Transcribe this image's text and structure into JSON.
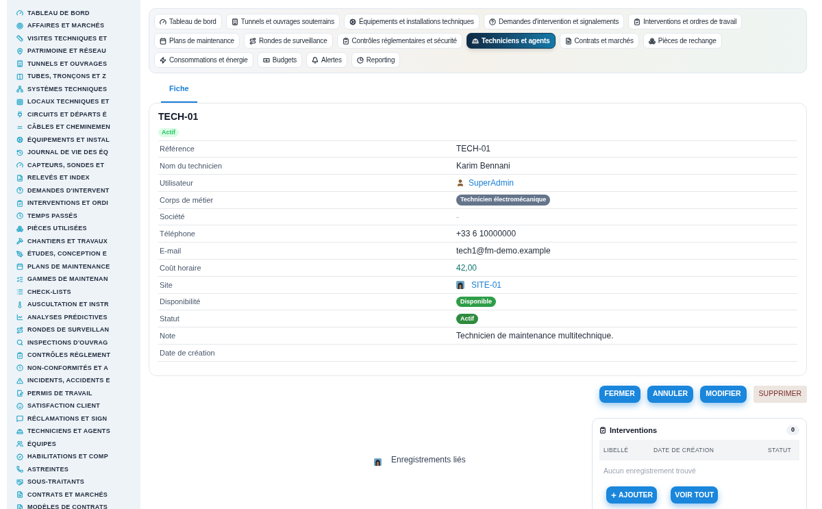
{
  "sidebar": {
    "items": [
      {
        "label": "TABLEAU DE BORD"
      },
      {
        "label": "AFFAIRES ET MARCHÉS"
      },
      {
        "label": "VISITES TECHNIQUES ET"
      },
      {
        "label": "PATRIMOINE ET RÉSEAU"
      },
      {
        "label": "TUNNELS ET OUVRAGES"
      },
      {
        "label": "TUBES, TRONÇONS ET Z"
      },
      {
        "label": "SYSTÈMES TECHNIQUES"
      },
      {
        "label": "LOCAUX TECHNIQUES ET"
      },
      {
        "label": "CIRCUITS ET DÉPARTS É"
      },
      {
        "label": "CÂBLES ET CHEMINEMEN"
      },
      {
        "label": "ÉQUIPEMENTS ET INSTAL"
      },
      {
        "label": "JOURNAL DE VIE DES ÉQ"
      },
      {
        "label": "CAPTEURS, SONDES ET"
      },
      {
        "label": "RELEVÉS ET INDEX"
      },
      {
        "label": "DEMANDES D'INTERVENT"
      },
      {
        "label": "INTERVENTIONS ET ORDI"
      },
      {
        "label": "TEMPS PASSÉS"
      },
      {
        "label": "PIÈCES UTILISÉES"
      },
      {
        "label": "CHANTIERS ET TRAVAUX"
      },
      {
        "label": "ÉTUDES, CONCEPTION E"
      },
      {
        "label": "PLANS DE MAINTENANCE"
      },
      {
        "label": "GAMMES DE MAINTENAN"
      },
      {
        "label": "CHECK-LISTS"
      },
      {
        "label": "AUSCULTATION ET INSTR"
      },
      {
        "label": "ANALYSES PRÉDICTIVES"
      },
      {
        "label": "RONDES DE SURVEILLAN"
      },
      {
        "label": "INSPECTIONS D'OUVRAG"
      },
      {
        "label": "CONTRÔLES RÉGLEMENT"
      },
      {
        "label": "NON-CONFORMITÉS ET A"
      },
      {
        "label": "INCIDENTS, ACCIDENTS E"
      },
      {
        "label": "PERMIS DE TRAVAIL"
      },
      {
        "label": "SATISFACTION CLIENT"
      },
      {
        "label": "RÉCLAMATIONS ET SIGN"
      },
      {
        "label": "TECHNICIENS ET AGENTS"
      },
      {
        "label": "ÉQUIPES"
      },
      {
        "label": "HABILITATIONS ET COMP"
      },
      {
        "label": "ASTREINTES"
      },
      {
        "label": "SOUS-TRAITANTS"
      },
      {
        "label": "CONTRATS ET MARCHÉS"
      },
      {
        "label": "MODÈLES DE CONTRATS"
      }
    ]
  },
  "module_tabs": [
    {
      "label": "Tableau de bord",
      "selected": false
    },
    {
      "label": "Tunnels et ouvrages souterrains",
      "selected": false
    },
    {
      "label": "Équipements et installations techniques",
      "selected": false
    },
    {
      "label": "Demandes d'intervention et signalements",
      "selected": false
    },
    {
      "label": "Interventions et ordres de travail",
      "selected": false
    },
    {
      "label": "Plans de maintenance",
      "selected": false
    },
    {
      "label": "Rondes de surveillance",
      "selected": false
    },
    {
      "label": "Contrôles réglementaires et sécurité",
      "selected": false
    },
    {
      "label": "Techniciens et agents",
      "selected": true
    },
    {
      "label": "Contrats et marchés",
      "selected": false
    },
    {
      "label": "Pièces de rechange",
      "selected": false
    },
    {
      "label": "Consommations et énergie",
      "selected": false
    },
    {
      "label": "Budgets",
      "selected": false
    },
    {
      "label": "Alertes",
      "selected": false
    },
    {
      "label": "Reporting",
      "selected": false
    }
  ],
  "view_tabs": [
    {
      "label": "Fiche",
      "selected": true
    }
  ],
  "record": {
    "title": "TECH-01",
    "status_badge": "Actif",
    "fields": [
      {
        "label": "Référence",
        "kind": "text",
        "value": "TECH-01"
      },
      {
        "label": "Nom du technicien",
        "kind": "text",
        "value": "Karim Bennani"
      },
      {
        "label": "Utilisateur",
        "kind": "user_link",
        "value": "SuperAdmin"
      },
      {
        "label": "Corps de métier",
        "kind": "pill",
        "value": "Technicien électromécanique",
        "color": "#64748b"
      },
      {
        "label": "Société",
        "kind": "muted",
        "value": "-"
      },
      {
        "label": "Téléphone",
        "kind": "text",
        "value": "+33 6 10000000"
      },
      {
        "label": "E-mail",
        "kind": "text",
        "value": "tech1@fm-demo.example"
      },
      {
        "label": "Coût horaire",
        "kind": "money",
        "value": "42,00"
      },
      {
        "label": "Site",
        "kind": "site_link",
        "value": "SITE-01"
      },
      {
        "label": "Disponibilité",
        "kind": "pill",
        "value": "Disponible",
        "color": "#2e9e48"
      },
      {
        "label": "Statut",
        "kind": "pill",
        "value": "Actif",
        "color": "#2e8b3e"
      },
      {
        "label": "Note",
        "kind": "text",
        "value": "Technicien de maintenance multitechnique."
      },
      {
        "label": "Date de création",
        "kind": "empty"
      }
    ]
  },
  "actions": [
    {
      "label": "FERMER",
      "kind": "primary"
    },
    {
      "label": "ANNULER",
      "kind": "primary"
    },
    {
      "label": "MODIFIER",
      "kind": "primary"
    },
    {
      "label": "SUPPRIMER",
      "kind": "danger"
    }
  ],
  "related": {
    "title": "Enregistrements liés"
  },
  "interventions": {
    "title": "Interventions",
    "count": "0",
    "columns": [
      "LIBELLÉ",
      "DATE DE CRÉATION",
      "STATUT"
    ],
    "empty_text": "Aucun enregistrement trouvé",
    "buttons": [
      {
        "label": "AJOUTER",
        "kind": "add"
      },
      {
        "label": "VOIR TOUT",
        "kind": "plain"
      }
    ]
  }
}
